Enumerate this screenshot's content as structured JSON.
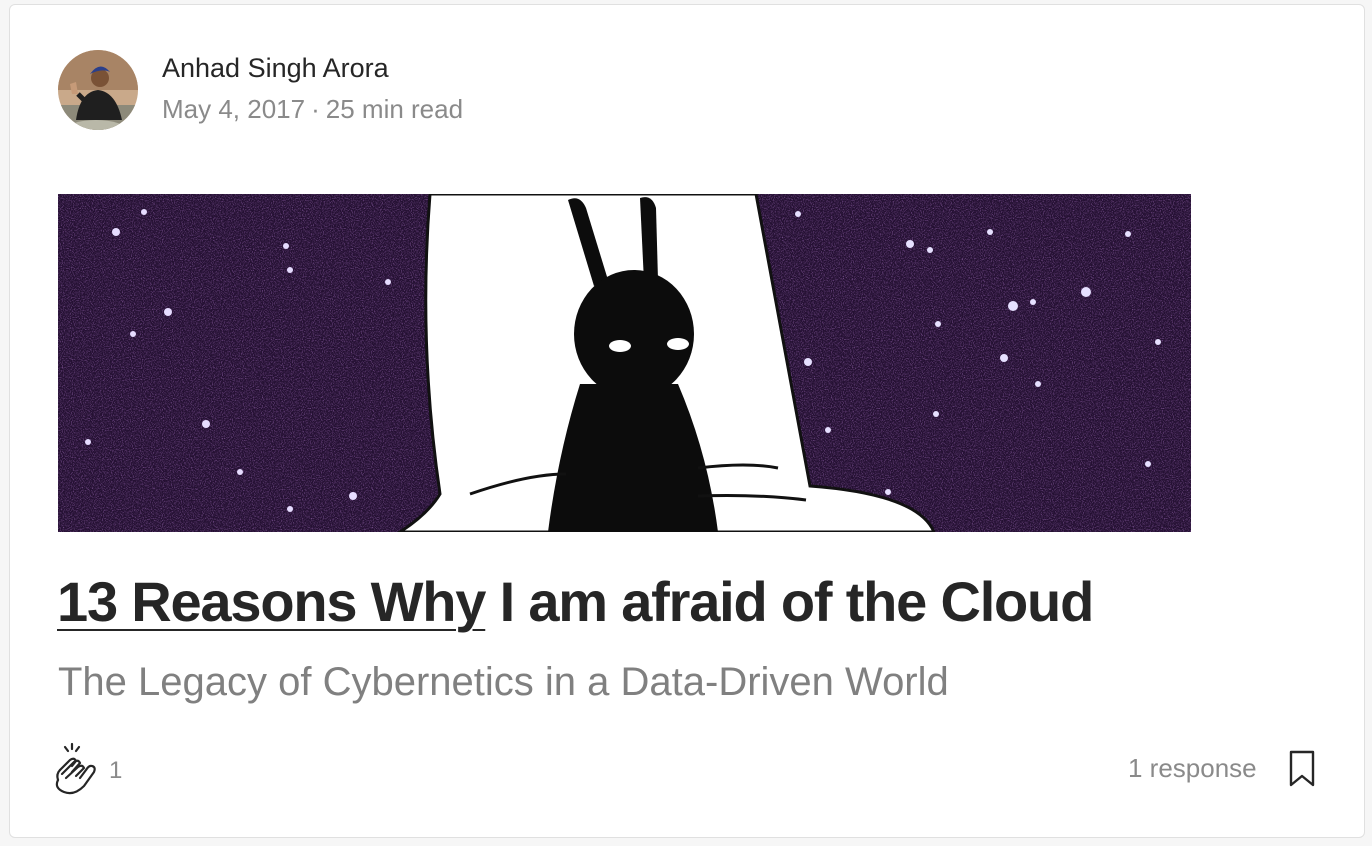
{
  "post": {
    "author": {
      "name": "Anhad Singh Arora",
      "avatar_icon": "author-avatar"
    },
    "date": "May 4, 2017",
    "separator": "·",
    "read_time": "25 min read",
    "hero_image": "illustration of a black rabbit figure against a purple starfield",
    "title_link": "13 Reasons Why",
    "title_rest": " I am afraid of the Cloud",
    "subtitle": "The Legacy of Cybernetics in a Data-Driven World",
    "claps": "1",
    "responses": "1 response",
    "icons": {
      "clap": "clap-icon",
      "bookmark": "bookmark-icon"
    },
    "colors": {
      "text": "#262626",
      "muted": "#8a8a8a",
      "starfield": "#2a0f3c"
    }
  }
}
